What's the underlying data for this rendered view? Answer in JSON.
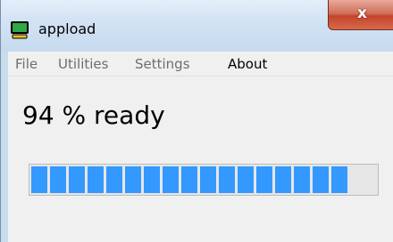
{
  "window": {
    "title": "appload",
    "close_glyph": "x",
    "app_icon": "monitor-icon"
  },
  "menu": {
    "items": [
      {
        "label": "File",
        "active": false
      },
      {
        "label": "Utilities",
        "active": false
      },
      {
        "label": "Settings",
        "active": false
      },
      {
        "label": "About",
        "active": true
      }
    ]
  },
  "status": {
    "text": "94 % ready"
  },
  "progress": {
    "percent": 94,
    "segmented": true
  },
  "colors": {
    "progress_fill": "#3399ff",
    "close_button": "#c9462c"
  }
}
